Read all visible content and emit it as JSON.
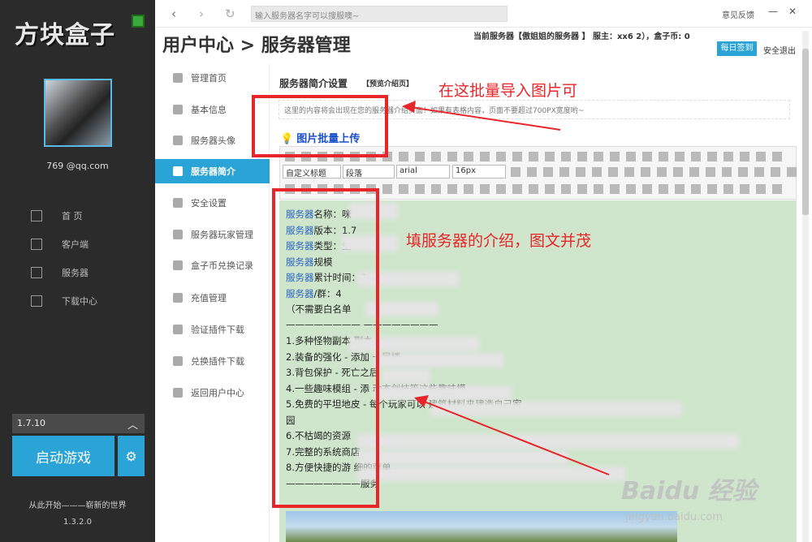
{
  "app": {
    "logo": "方块盒子"
  },
  "topbar": {
    "back": "‹",
    "forward": "›",
    "refresh": "↻",
    "search_placeholder": "输入服务器名字可以搜服噢~",
    "feedback": "意见反馈"
  },
  "user": {
    "email": "769      @qq.com"
  },
  "left_nav": [
    {
      "label": "首 页",
      "icon": "home-icon"
    },
    {
      "label": "客户端",
      "icon": "grid-icon"
    },
    {
      "label": "服务器",
      "icon": "server-icon"
    },
    {
      "label": "下载中心",
      "icon": "download-icon"
    }
  ],
  "launcher": {
    "version": "1.7.10",
    "launch_label": "启动游戏",
    "slogan": "从此开始———崭新的世界",
    "app_version": "1.3.2.0"
  },
  "header": {
    "title": "用户中心 > 服务器管理",
    "info": "当前服务器【傲姐姐的服务器            】 服主：xx6                2），盒子币: 0",
    "checkin": "每日签到",
    "logout": "安全退出"
  },
  "sub_nav": [
    {
      "label": "管理首页",
      "active": false
    },
    {
      "label": "基本信息",
      "active": false
    },
    {
      "label": "服务器头像",
      "active": false
    },
    {
      "label": "服务器简介",
      "active": true
    },
    {
      "label": "安全设置",
      "active": false
    },
    {
      "label": "服务器玩家管理",
      "active": false
    },
    {
      "label": "盒子币兑换记录",
      "active": false
    },
    {
      "label": "充值管理",
      "active": false
    },
    {
      "label": "验证插件下载",
      "active": false
    },
    {
      "label": "兑换插件下载",
      "active": false
    },
    {
      "label": "返回用户中心",
      "active": false
    }
  ],
  "content": {
    "title": "服务器简介设置",
    "tag": "【预览介绍页】",
    "hint": "这里的内容将会出现在您的服务器介绍页面！如果有表格内容，页面不要超过700PX宽度哟~",
    "upload": "图片批量上传"
  },
  "editor": {
    "selects": [
      "自定义标题",
      "段落",
      "arial",
      "16px"
    ],
    "lines": [
      {
        "pre": "服务器",
        "text": "名称：咪"
      },
      {
        "pre": "服务器",
        "text": "版本：1.7"
      },
      {
        "pre": "服务器",
        "text": "类型：生"
      },
      {
        "pre": "服务器",
        "text": "规模"
      },
      {
        "pre": "服务器",
        "text": "累计时间：2"
      },
      {
        "pre": "服务器",
        "text": "/群：4"
      },
      {
        "pre": "",
        "text": "（不需要白名单"
      },
      {
        "pre": "",
        "text": "————————                    ————————"
      },
      {
        "pre": "",
        "text": "1.多种怪物副本                                              副本"
      },
      {
        "pre": "",
        "text": "2.装备的强化 - 添加                                          一层楼"
      },
      {
        "pre": "",
        "text": "3.背包保护 - 死亡之后"
      },
      {
        "pre": "",
        "text": "4.一些趣味模组 - 添                                       动态剑技等这些趣味模"
      },
      {
        "pre": "",
        "text": "5.免费的平坦地皮 - 每个玩家可以                                            建筑材料来建造自己家"
      },
      {
        "pre": "",
        "text": "园"
      },
      {
        "pre": "",
        "text": "6.不枯竭的资源"
      },
      {
        "pre": "",
        "text": "7.完整的系统商店"
      },
      {
        "pre": "",
        "text": "8.方便快捷的游                                                                   细的菜单"
      },
      {
        "pre": "",
        "text": "————————服务"
      }
    ]
  },
  "annotations": {
    "top": "在这批量导入图片可",
    "middle": "填服务器的介绍，图文并茂"
  },
  "watermark": {
    "brand": "Baidu 经验",
    "url": "jingyan.baidu.com"
  },
  "colors": {
    "accent": "#2aa3d6",
    "annotation": "#e8262a",
    "sidebar": "#2b2b2b",
    "editor_bg": "#cfe6cc"
  }
}
